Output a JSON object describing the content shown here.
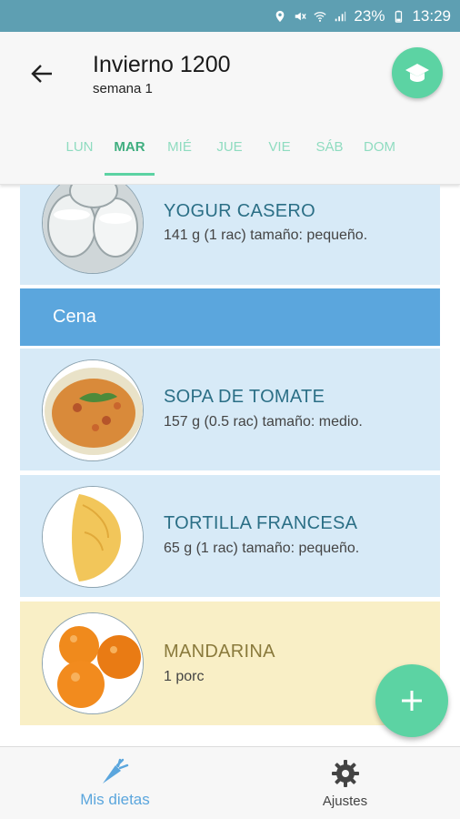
{
  "status_bar": {
    "battery": "23%",
    "time": "13:29"
  },
  "header": {
    "title": "Invierno 1200",
    "subtitle": "semana 1",
    "days": [
      {
        "label": "LUN",
        "active": false
      },
      {
        "label": "MAR",
        "active": true
      },
      {
        "label": "MIÉ",
        "active": false
      },
      {
        "label": "JUE",
        "active": false
      },
      {
        "label": "VIE",
        "active": false
      },
      {
        "label": "SÁB",
        "active": false
      },
      {
        "label": "DOM",
        "active": false
      }
    ]
  },
  "meals": {
    "items_before": [
      {
        "name": "YOGUR CASERO",
        "detail": "141 g (1 rac) tamaño: pequeño."
      }
    ],
    "section_cena": "Cena",
    "items_cena": [
      {
        "name": "SOPA DE TOMATE",
        "detail": "157 g (0.5 rac) tamaño: medio."
      },
      {
        "name": "TORTILLA FRANCESA",
        "detail": "65 g (1 rac) tamaño: pequeño."
      },
      {
        "name": "MANDARINA",
        "detail": "1 porc"
      }
    ]
  },
  "bottom_nav": {
    "diets_label": "Mis dietas",
    "settings_label": "Ajustes"
  },
  "colors": {
    "accent": "#5cd3a3",
    "section": "#5ba6dd",
    "card_blue": "#d7eaf7",
    "card_yellow": "#f9efc6"
  }
}
